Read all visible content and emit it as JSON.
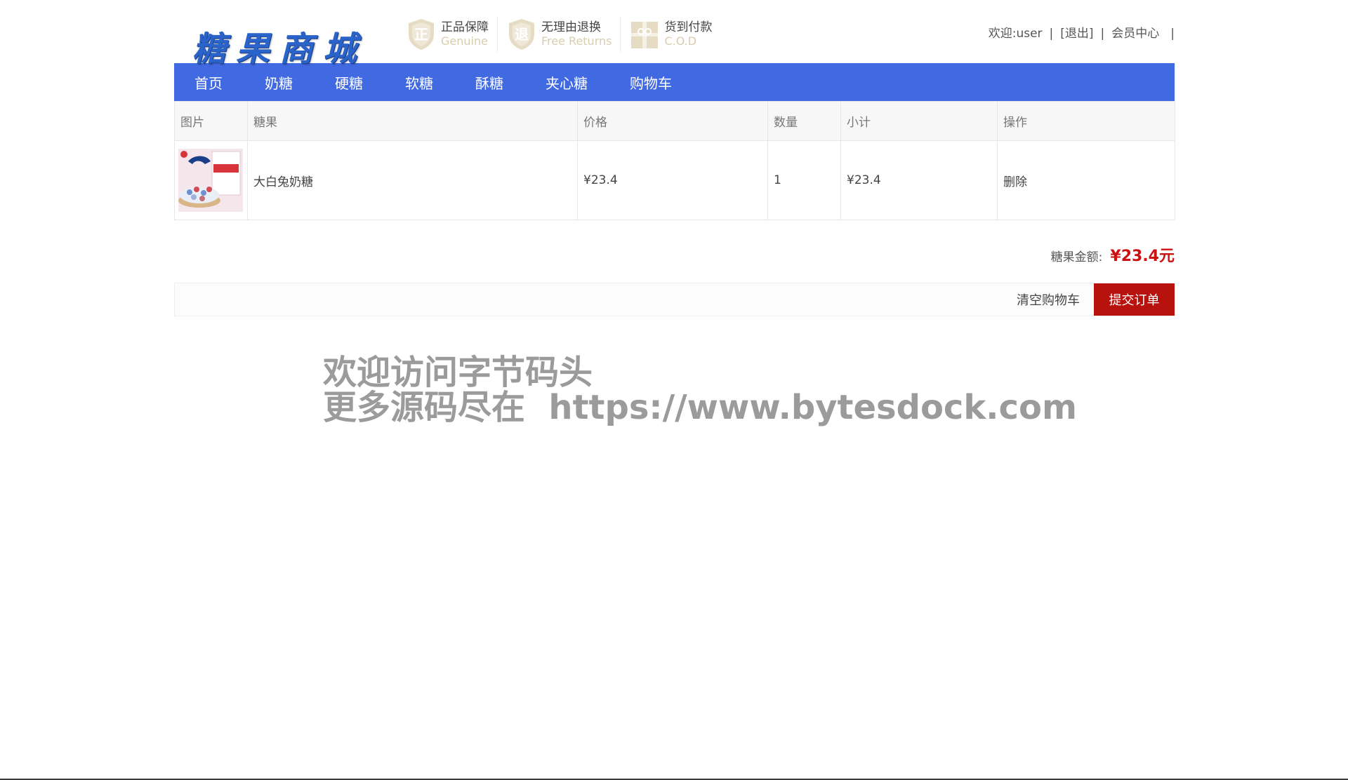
{
  "header": {
    "logo_text": "糖果商城",
    "promises": [
      {
        "title": "正品保障",
        "subtitle": "Genuine",
        "icon": "genuine-shield-icon"
      },
      {
        "title": "无理由退换",
        "subtitle": "Free Returns",
        "icon": "returns-shield-icon"
      },
      {
        "title": "货到付款",
        "subtitle": "C.O.D",
        "icon": "gift-box-icon"
      }
    ],
    "user_bar": {
      "welcome": "欢迎:user",
      "logout": "[退出]",
      "member_center": "会员中心",
      "separator": "|"
    }
  },
  "nav": {
    "items": [
      "首页",
      "奶糖",
      "硬糖",
      "软糖",
      "酥糖",
      "夹心糖",
      "购物车"
    ]
  },
  "cart": {
    "columns": [
      "图片",
      "糖果",
      "价格",
      "数量",
      "小计",
      "操作"
    ],
    "rows": [
      {
        "name": "大白兔奶糖",
        "price": "¥23.4",
        "quantity": "1",
        "subtotal": "¥23.4",
        "action": "删除"
      }
    ],
    "total_label": "糖果金额:",
    "total_value": "¥23.4元",
    "clear_label": "清空购物车",
    "submit_label": "提交订单"
  },
  "watermark": {
    "line1": "欢迎访问字节码头",
    "line2": "更多源码尽在  https://www.bytesdock.com"
  },
  "colors": {
    "nav_bg": "#4169e1",
    "submit_bg": "#b8120e",
    "price_red": "#cc1111",
    "logo_blue": "#2a63c9",
    "promise_gold": "#d9cdb0"
  }
}
